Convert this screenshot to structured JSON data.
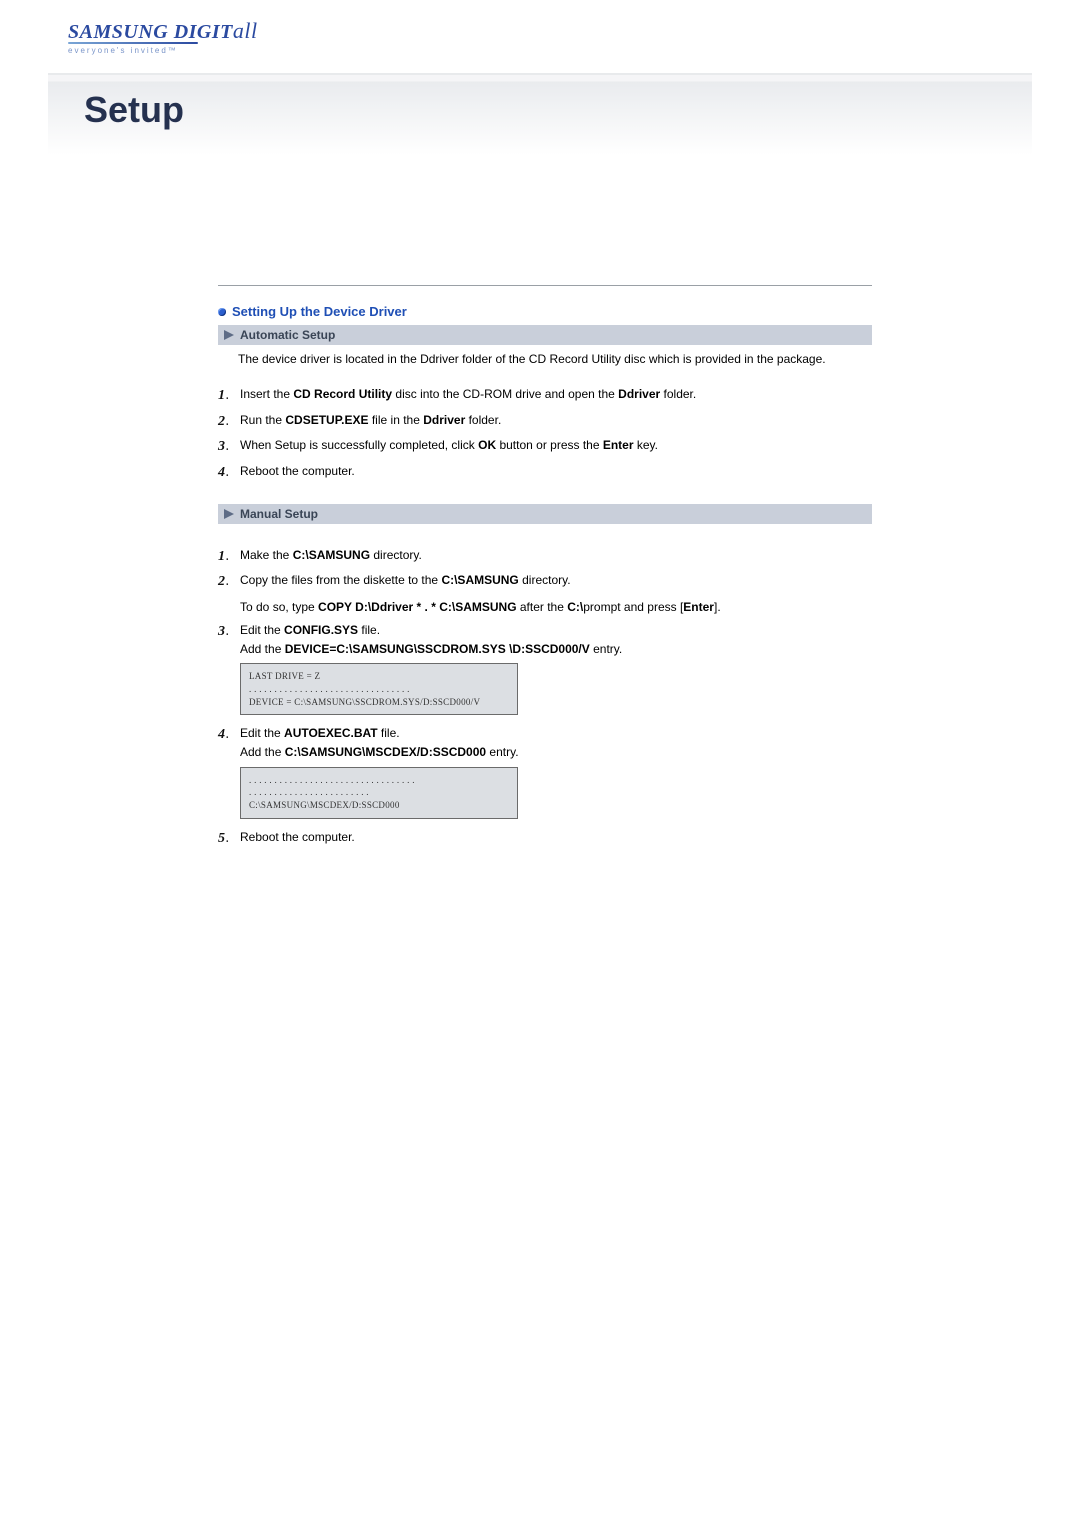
{
  "logo": {
    "brand": "SAMSUNG DIGITall",
    "tagline": "everyone's invited™"
  },
  "banner": {
    "title": "Setup"
  },
  "section": {
    "title": "Setting Up the Device Driver"
  },
  "auto": {
    "header": "Automatic Setup",
    "intro": "The device driver is located in the Ddriver folder of the CD Record Utility disc which is provided in the package.",
    "s1": {
      "a": "Insert the ",
      "b": "CD Record Utility",
      "c": " disc into the CD-ROM drive and open the ",
      "d": "Ddriver",
      "e": " folder."
    },
    "s2": {
      "a": "Run the ",
      "b": "CDSETUP.EXE",
      "c": " file in the ",
      "d": "Ddriver",
      "e": " folder."
    },
    "s3": {
      "a": "When Setup is successfully completed, click ",
      "b": "OK",
      "c": " button or press the ",
      "d": "Enter",
      "e": " key."
    },
    "s4": {
      "a": "Reboot the computer."
    }
  },
  "manual": {
    "header": "Manual Setup",
    "s1": {
      "a": "Make the ",
      "b": "C:\\SAMSUNG",
      "c": " directory."
    },
    "s2": {
      "a": "Copy the files from the diskette to the ",
      "b": "C:\\SAMSUNG",
      "c": " directory."
    },
    "s2b": {
      "a": "To do so, type ",
      "b": "COPY D:\\Ddriver * . * C:\\SAMSUNG",
      "c": " after the ",
      "d": "C:\\",
      "e": "prompt and press [",
      "f": "Enter",
      "g": "]."
    },
    "s3": {
      "a": "Edit the ",
      "b": "CONFIG.SYS",
      "c": " file."
    },
    "s3b": {
      "a": "Add the ",
      "b": "DEVICE=C:\\SAMSUNG\\SSCDROM.SYS \\D:SSCD000/V",
      "c": " entry."
    },
    "code1": "LAST DRIVE = Z\n. . . . . . . . . . . . . . . . . . . . . . . . . . . . . . . .\nDEVICE = C:\\SAMSUNG\\SSCDROM.SYS/D:SSCD000/V",
    "s4": {
      "a": "Edit the ",
      "b": "AUTOEXEC.BAT",
      "c": " file."
    },
    "s4b": {
      "a": "Add the ",
      "b": "C:\\SAMSUNG\\MSCDEX/D:SSCD000",
      "c": " entry."
    },
    "code2": ". . . . . . . . . . . . . . . . . . . . . . . . . . . . . . . . .\n. . . . . . . . . . . . . . . . . . . . . . . .\nC:\\SAMSUNG\\MSCDEX/D:SSCD000",
    "s5": {
      "a": "Reboot the computer."
    }
  },
  "nums": {
    "n1": "1",
    "n2": "2",
    "n3": "3",
    "n4": "4",
    "n5": "5",
    "dot": "."
  }
}
